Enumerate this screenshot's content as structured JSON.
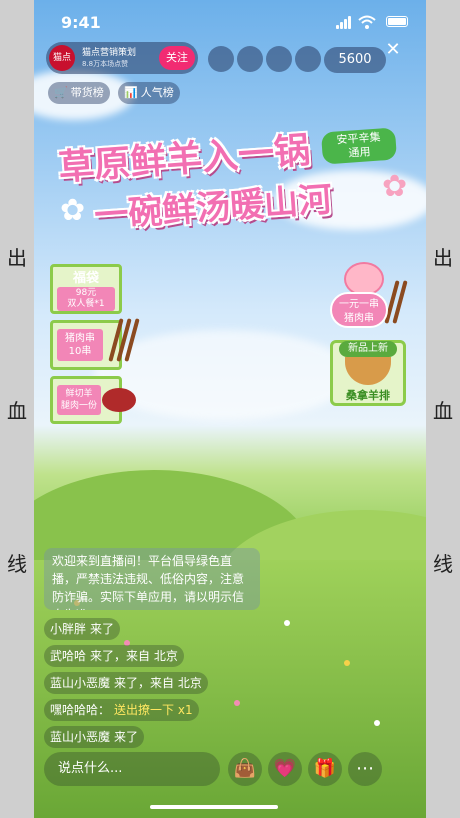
{
  "side_left": [
    "出",
    "血",
    "线"
  ],
  "side_right": [
    "出",
    "血",
    "线"
  ],
  "status": {
    "time": "9:41"
  },
  "host": {
    "avatar_text": "猫点",
    "name": "猫点营销策划",
    "sub": "8.8万本场点赞",
    "follow_label": "关注"
  },
  "viewer_count": "5600",
  "close_glyph": "✕",
  "ranks": [
    {
      "icon": "🛒",
      "label": "带货榜"
    },
    {
      "icon": "📊",
      "label": "人气榜"
    }
  ],
  "headline": {
    "line1": "草原鲜羊入一锅",
    "line2": "一碗鲜汤暖山河"
  },
  "badge": {
    "line1": "安平辛集",
    "line2": "通用"
  },
  "left_cards": [
    {
      "title": "福袋",
      "line1": "98元",
      "line2": "双人餐*1"
    },
    {
      "line1": "猪肉串",
      "line2": "10串"
    },
    {
      "line1": "鲜切羊",
      "line2": "腿肉一份"
    }
  ],
  "right_cards": {
    "pig_line1": "一元一串",
    "pig_line2": "猪肉串",
    "new_title": "新品上新",
    "new_label": "桑拿羊排"
  },
  "notice": "欢迎来到直播间！平台倡导绿色直播，严禁违法违规、低俗内容，注意防诈骗。实际下单应用，请以明示信息为准。",
  "chat": [
    {
      "user": "小胖胖",
      "text": "来了"
    },
    {
      "user": "武哈哈",
      "text": "来了，来自",
      "place": "北京"
    },
    {
      "user": "蓝山小恶魔",
      "text": "来了，来自",
      "place": "北京"
    },
    {
      "user": "嘿哈哈哈：",
      "gift": "送出撩一下",
      "count": "x1"
    },
    {
      "user": "蓝山小恶魔",
      "text": "来了"
    }
  ],
  "input_placeholder": "说点什么...",
  "bottom_icons": [
    "shopping-bag-icon",
    "heart-icon",
    "gift-icon",
    "more-icon"
  ],
  "bottom_glyphs": [
    "👜",
    "💗",
    "🎁",
    "⋯"
  ]
}
